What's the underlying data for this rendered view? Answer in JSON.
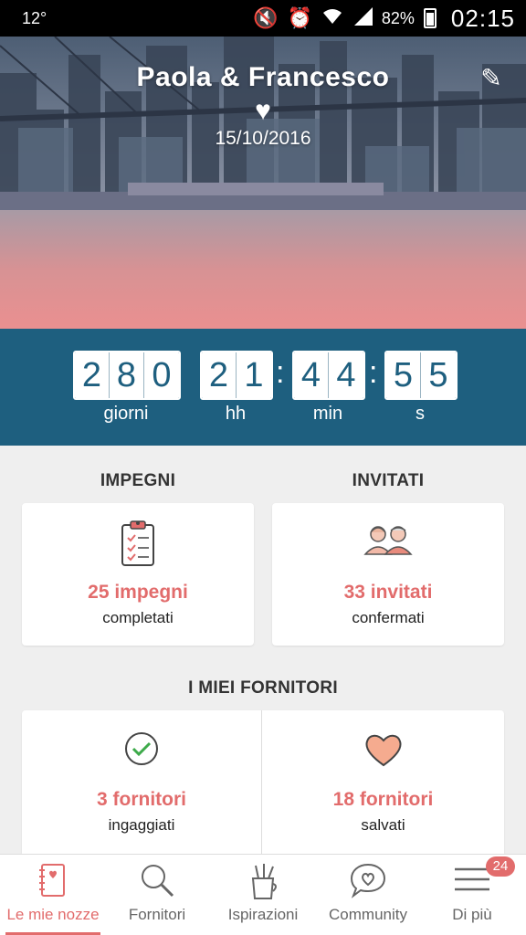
{
  "status_bar": {
    "temperature": "12°",
    "battery": "82%",
    "time": "02:15"
  },
  "hero": {
    "couple_name": "Paola & Francesco",
    "date": "15/10/2016"
  },
  "countdown": {
    "days": [
      "2",
      "8",
      "0"
    ],
    "hours": [
      "2",
      "1"
    ],
    "minutes": [
      "4",
      "4"
    ],
    "seconds": [
      "5",
      "5"
    ],
    "labels": {
      "days": "giorni",
      "hours": "hh",
      "minutes": "min",
      "seconds": "s"
    }
  },
  "sections": {
    "impegni": {
      "title": "IMPEGNI",
      "value": "25 impegni",
      "caption": "completati"
    },
    "invitati": {
      "title": "INVITATI",
      "value": "33 invitati",
      "caption": "confermati"
    },
    "fornitori": {
      "title": "I MIEI FORNITORI",
      "hired": {
        "value": "3 fornitori",
        "caption": "ingaggiati"
      },
      "saved": {
        "value": "18 fornitori",
        "caption": "salvati"
      }
    }
  },
  "bottom_nav": {
    "items": [
      {
        "label": "Le mie nozze",
        "icon": "notebook-icon",
        "active": true
      },
      {
        "label": "Fornitori",
        "icon": "search-icon",
        "active": false
      },
      {
        "label": "Ispirazioni",
        "icon": "brushes-cup-icon",
        "active": false
      },
      {
        "label": "Community",
        "icon": "chat-heart-icon",
        "active": false
      },
      {
        "label": "Di più",
        "icon": "menu-icon",
        "active": false,
        "badge": "24"
      }
    ]
  },
  "colors": {
    "accent": "#e26c6c",
    "countdown_bg": "#1e5f7f",
    "background": "#efefef"
  }
}
